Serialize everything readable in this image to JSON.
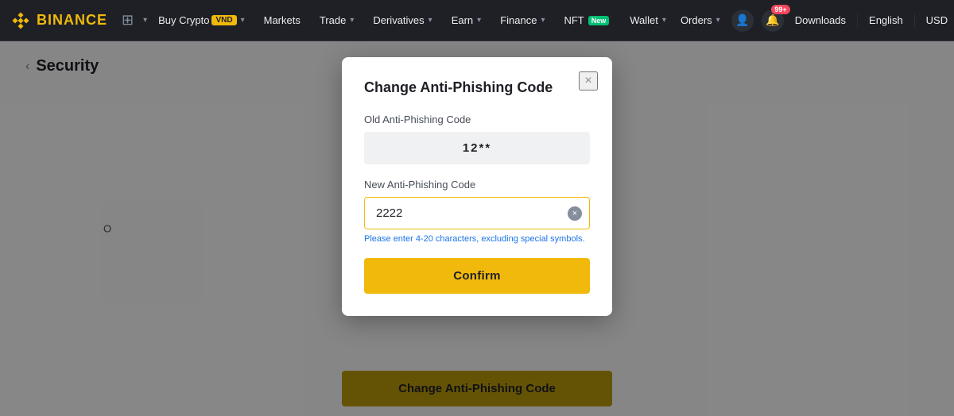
{
  "navbar": {
    "logo_text": "BINANCE",
    "menu_items": [
      {
        "label": "Buy Crypto",
        "badge": "VND",
        "has_chevron": true
      },
      {
        "label": "Markets",
        "has_chevron": false
      },
      {
        "label": "Trade",
        "has_chevron": true
      },
      {
        "label": "Derivatives",
        "has_chevron": true
      },
      {
        "label": "Earn",
        "has_chevron": true
      },
      {
        "label": "Finance",
        "has_chevron": true
      },
      {
        "label": "NFT",
        "badge_new": "New",
        "has_chevron": false
      }
    ],
    "right_items": [
      {
        "label": "Wallet",
        "has_chevron": true
      },
      {
        "label": "Orders",
        "has_chevron": true
      }
    ],
    "downloads_label": "Downloads",
    "language_label": "English",
    "currency_label": "USD",
    "notifications_count": "99+"
  },
  "breadcrumb": {
    "back_arrow": "‹",
    "title": "Security"
  },
  "modal": {
    "title": "Change Anti-Phishing Code",
    "close_symbol": "×",
    "old_code_label": "Old Anti-Phishing Code",
    "old_code_value": "12**",
    "new_code_label": "New Anti-Phishing Code",
    "new_code_value": "2222",
    "new_code_placeholder": "",
    "input_hint": "Please enter 4-20 characters, excluding special symbols.",
    "confirm_label": "Confirm",
    "clear_symbol": "×"
  },
  "bottom_button": {
    "label": "Change Anti-Phishing Code"
  },
  "side_label": "O"
}
